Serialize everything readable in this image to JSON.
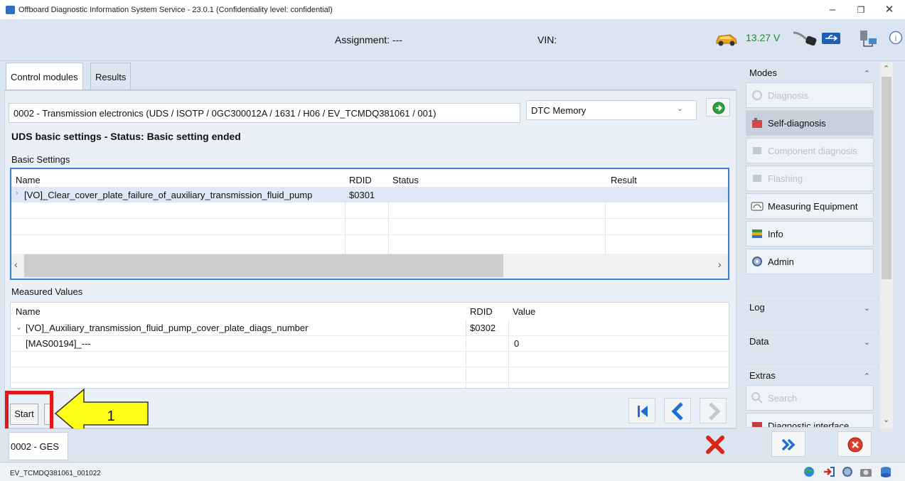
{
  "window": {
    "title": "Offboard Diagnostic Information System Service - 23.0.1 (Confidentiality level: confidential)",
    "minimize": "–",
    "maximize": "❐",
    "close": "✕"
  },
  "header": {
    "assignment": "Assignment: ---",
    "vin": "VIN:",
    "voltage": "13.27 V"
  },
  "tabs": [
    {
      "label": "Control modules",
      "active": true
    },
    {
      "label": "Results",
      "active": false
    }
  ],
  "module": {
    "description": "0002 - Transmission electronics  (UDS / ISOTP / 0GC300012A / 1631 / H06 / EV_TCMDQ381061 / 001)",
    "mode_select": "DTC Memory"
  },
  "status_text": "UDS basic settings - Status: Basic setting ended",
  "basic_settings": {
    "title": "Basic Settings",
    "columns": [
      "Name",
      "RDID",
      "Status",
      "Result"
    ],
    "rows": [
      {
        "name": "[VO]_Clear_cover_plate_failure_of_auxiliary_transmission_fluid_pump",
        "rdid": "$0301",
        "status": "",
        "result": ""
      }
    ]
  },
  "measured_values": {
    "title": "Measured Values",
    "columns": [
      "Name",
      "RDID",
      "Value"
    ],
    "rows": [
      {
        "name": "[VO]_Auxiliary_transmission_fluid_pump_cover_plate_diags_number",
        "rdid": "$0302",
        "value": ""
      },
      {
        "name": "[MAS00194]_---",
        "rdid": "",
        "value": "0"
      }
    ]
  },
  "controls": {
    "start": "Start",
    "annotation_number": "1"
  },
  "status_strip": {
    "module": "0002 - GES"
  },
  "sidebar": {
    "modes_title": "Modes",
    "modes": [
      {
        "label": "Diagnosis",
        "state": "disabled",
        "icon": "stethoscope-icon"
      },
      {
        "label": "Self-diagnosis",
        "state": "active",
        "icon": "car-ecu-icon"
      },
      {
        "label": "Component diagnosis",
        "state": "disabled",
        "icon": "component-icon"
      },
      {
        "label": "Flashing",
        "state": "disabled",
        "icon": "flash-icon"
      },
      {
        "label": "Measuring Equipment",
        "state": "normal",
        "icon": "gauge-icon"
      },
      {
        "label": "Info",
        "state": "normal",
        "icon": "book-icon"
      },
      {
        "label": "Admin",
        "state": "normal",
        "icon": "admin-gear-icon"
      }
    ],
    "log_title": "Log",
    "data_title": "Data",
    "extras_title": "Extras",
    "extras": [
      {
        "label": "Search",
        "state": "disabled",
        "icon": "search-icon"
      },
      {
        "label": "Diagnostic interface",
        "state": "normal",
        "icon": "interface-icon"
      }
    ]
  },
  "footer": {
    "file": "EV_TCMDQ381061_001022"
  },
  "colors": {
    "accent_blue": "#3a7fd4",
    "highlight_red": "#e01818",
    "arrow_yellow": "#ffff1a",
    "voltage_green": "#1a8a2a"
  }
}
